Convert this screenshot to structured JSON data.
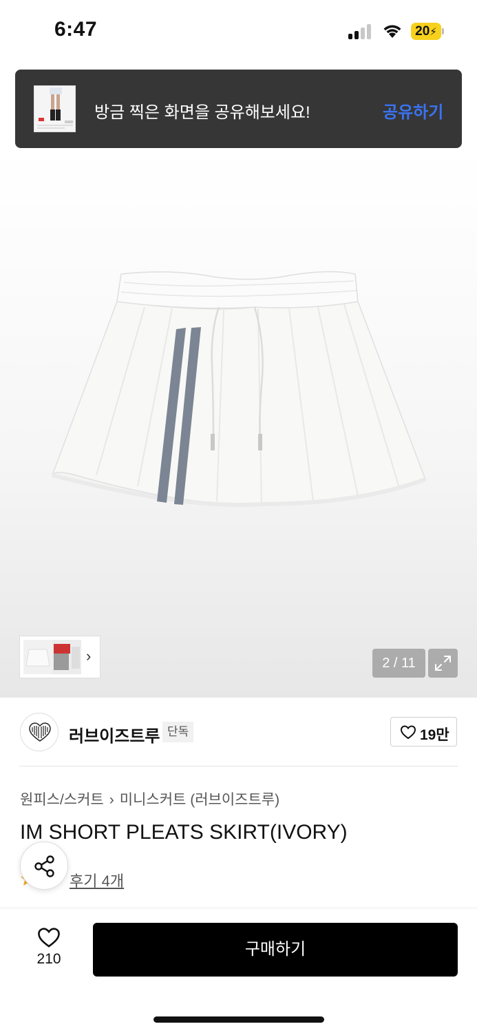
{
  "status_bar": {
    "time": "6:47",
    "battery": "20",
    "battery_color": "#f7d11c"
  },
  "toast": {
    "message": "방금 찍은 화면을 공유해보세요!",
    "action": "공유하기",
    "action_color": "#3a73f1"
  },
  "gallery": {
    "counter": "2 / 11",
    "thumb_chevron": "›"
  },
  "brand": {
    "name": "러브이즈트루",
    "badge": "단독",
    "like_count": "19만"
  },
  "product": {
    "breadcrumb": [
      "원피스/스커트",
      "미니스커트 (러브이즈트루)"
    ],
    "breadcrumb_separator": "›",
    "title": "IM SHORT PLEATS SKIRT(IVORY)",
    "review_link": "후기 4개",
    "star_color": "#f5a623"
  },
  "bottom_bar": {
    "wish_count": "210",
    "buy_label": "구매하기"
  },
  "icons": [
    "signal-icon",
    "wifi-icon",
    "battery-icon",
    "expand-icon",
    "heart-icon",
    "share-icon",
    "star-icon",
    "chevron-right-icon"
  ]
}
